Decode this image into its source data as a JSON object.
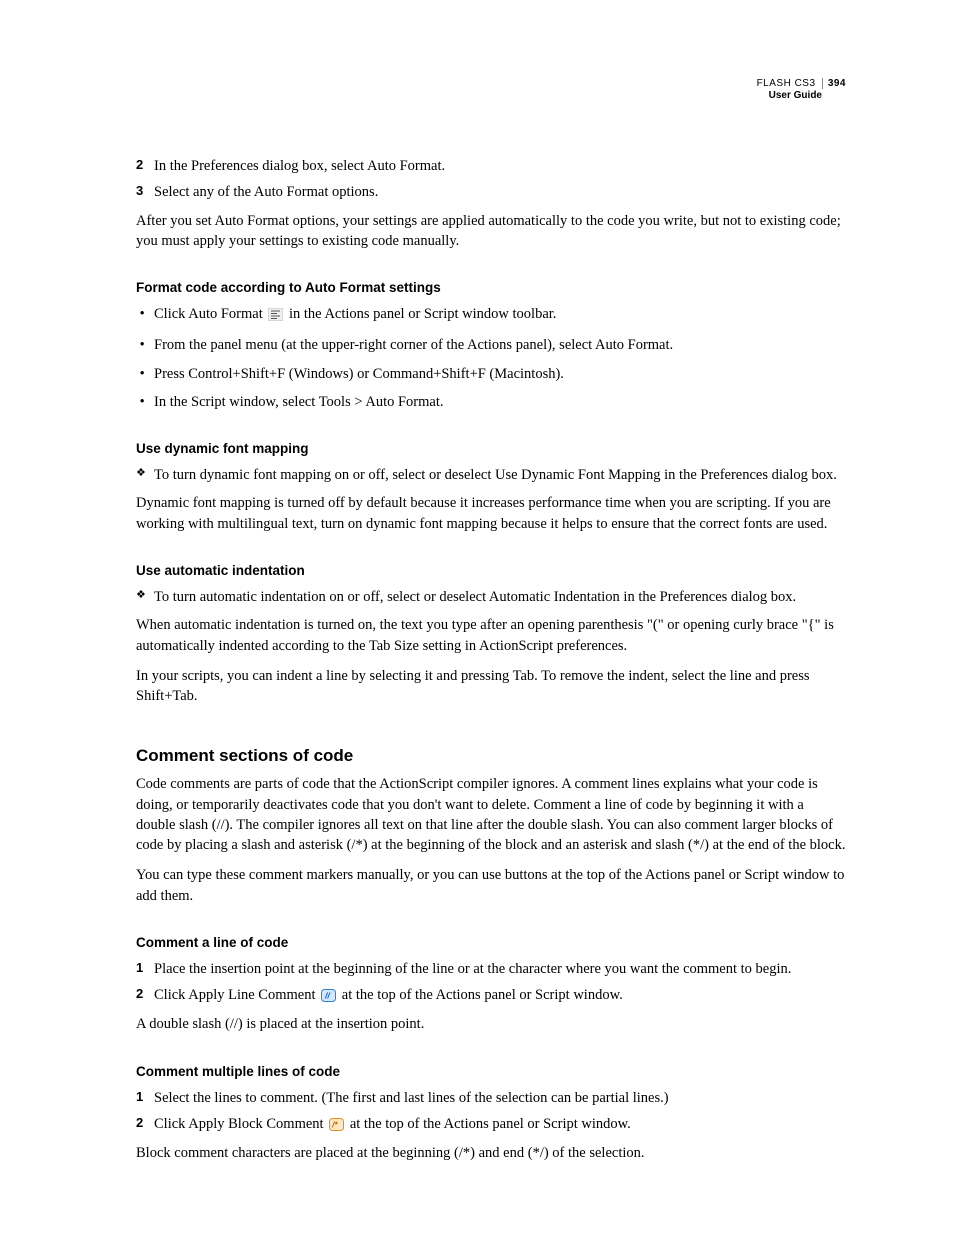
{
  "header": {
    "product": "FLASH CS3",
    "page_number": "394",
    "subtitle": "User Guide"
  },
  "step2": "In the Preferences dialog box, select Auto Format.",
  "step3": "Select any of the Auto Format options.",
  "para_after_steps": "After you set Auto Format options, your settings are applied automatically to the code you write, but not to existing code; you must apply your settings to existing code manually.",
  "h_format": "Format code according to Auto Format settings",
  "format_b1_a": "Click Auto Format ",
  "format_b1_b": " in the Actions panel or Script window toolbar.",
  "format_b2": "From the panel menu (at the upper-right corner of the Actions panel), select Auto Format.",
  "format_b3": "Press Control+Shift+F (Windows) or Command+Shift+F (Macintosh).",
  "format_b4": "In the Script window, select Tools > Auto Format.",
  "h_dynfont": "Use dynamic font mapping",
  "dynfont_b1": "To turn dynamic font mapping on or off, select or deselect Use Dynamic Font Mapping in the Preferences dialog box.",
  "dynfont_para": "Dynamic font mapping is turned off by default because it increases performance time when you are scripting. If you are working with multilingual text, turn on dynamic font mapping because it helps to ensure that the correct fonts are used.",
  "h_indent": "Use automatic indentation",
  "indent_b1": "To turn automatic indentation on or off, select or deselect Automatic Indentation in the Preferences dialog box.",
  "indent_para1": "When automatic indentation is turned on, the text you type after an opening parenthesis \"(\" or opening curly brace \"{\" is automatically indented according to the Tab Size setting in ActionScript preferences.",
  "indent_para2": "In your scripts, you can indent a line by selecting it and pressing Tab. To remove the indent, select the line and press Shift+Tab.",
  "h_comment": "Comment sections of code",
  "comment_para1": "Code comments are parts of code that the ActionScript compiler ignores. A comment lines explains what your code is doing, or temporarily deactivates code that you don't want to delete. Comment a line of code by beginning it with a double slash (//). The compiler ignores all text on that line after the double slash. You can also comment larger blocks of code by placing a slash and asterisk (/*) at the beginning of the block and an asterisk and slash (*/) at the end of the block.",
  "comment_para2": "You can type these comment markers manually, or you can use buttons at the top of the Actions panel or Script window to add them.",
  "h_comment_line": "Comment a line of code",
  "cline_s1": "Place the insertion point at the beginning of the line or at the character where you want the comment to begin.",
  "cline_s2_a": "Click Apply Line Comment ",
  "cline_s2_b": " at the top of the Actions panel or Script window.",
  "cline_para": "A double slash (//) is placed at the insertion point.",
  "h_comment_multi": "Comment multiple lines of code",
  "cmulti_s1": "Select the lines to comment. (The first and last lines of the selection can be partial lines.)",
  "cmulti_s2_a": "Click Apply Block Comment ",
  "cmulti_s2_b": " at the top of the Actions panel or Script window.",
  "cmulti_para": "Block comment characters are placed at the beginning (/*) and end (*/) of the selection."
}
